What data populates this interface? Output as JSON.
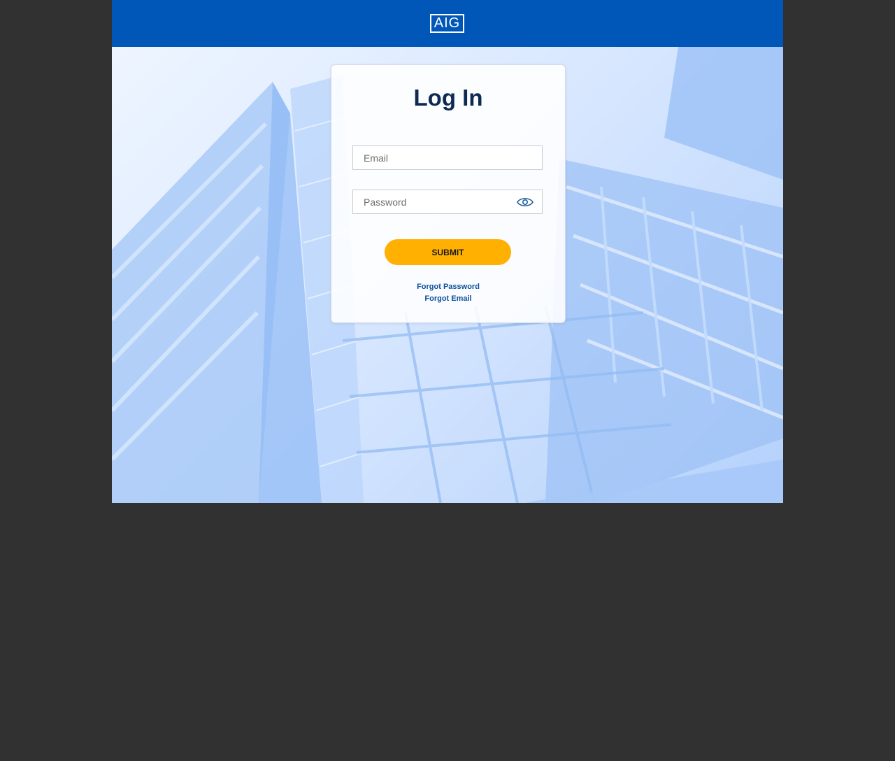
{
  "header": {
    "logo_text": "AIG",
    "background": "#0057b8"
  },
  "login": {
    "title": "Log In",
    "email": {
      "placeholder": "Email",
      "value": ""
    },
    "password": {
      "placeholder": "Password",
      "value": "",
      "toggle_icon": "eye-icon"
    },
    "submit_label": "SUBMIT",
    "submit_color": "#ffb000",
    "links": {
      "forgot_password": "Forgot Password",
      "forgot_email": "Forgot Email"
    }
  }
}
